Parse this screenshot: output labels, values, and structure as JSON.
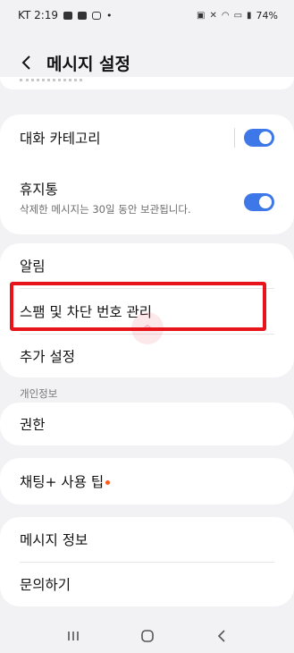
{
  "status_bar": {
    "carrier_time": "KT 2:19",
    "battery": "74%",
    "dot": "•"
  },
  "header": {
    "title": "메시지 설정"
  },
  "settings": {
    "chat_categories": {
      "label": "대화 카테고리",
      "enabled": true
    },
    "trash": {
      "label": "휴지통",
      "subtitle": "삭제한 메시지는 30일 동안 보관됩니다.",
      "enabled": true
    },
    "notifications": {
      "label": "알림"
    },
    "spam_block": {
      "label": "스팸 및 차단 번호 관리"
    },
    "more_settings": {
      "label": "추가 설정"
    },
    "privacy_section": {
      "label": "개인정보"
    },
    "permissions": {
      "label": "권한"
    },
    "chat_plus_tips": {
      "label": "채팅+ 사용 팁"
    },
    "about_messages": {
      "label": "메시지 정보"
    },
    "contact_us": {
      "label": "문의하기"
    }
  },
  "colors": {
    "accent": "#3e78e8",
    "highlight": "#e8141c",
    "badge": "#ff5a1e"
  }
}
